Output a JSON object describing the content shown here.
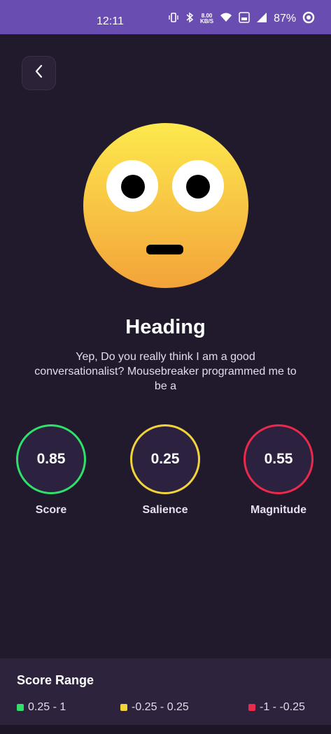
{
  "status_bar": {
    "time": "12:11",
    "net_speed_value": "8.00",
    "net_speed_unit": "KB/S",
    "battery": "87%"
  },
  "header": {
    "back_icon": "chevron-left-icon"
  },
  "emoji": {
    "icon": "flushed-face-emoji"
  },
  "content": {
    "heading": "Heading",
    "message": "Yep, Do you really think I am a good conversationalist? Mousebreaker programmed me to be a"
  },
  "metrics": [
    {
      "value": "0.85",
      "label": "Score",
      "color": "#2fe06a"
    },
    {
      "value": "0.25",
      "label": "Salience",
      "color": "#f0d43a"
    },
    {
      "value": "0.55",
      "label": "Magnitude",
      "color": "#ea2a4a"
    }
  ],
  "score_range": {
    "title": "Score Range",
    "items": [
      {
        "label": "0.25 - 1",
        "color": "#2fe06a"
      },
      {
        "label": "-0.25 - 0.25",
        "color": "#f0d43a"
      },
      {
        "label": "-1 - -0.25",
        "color": "#ea2a4a"
      }
    ]
  }
}
